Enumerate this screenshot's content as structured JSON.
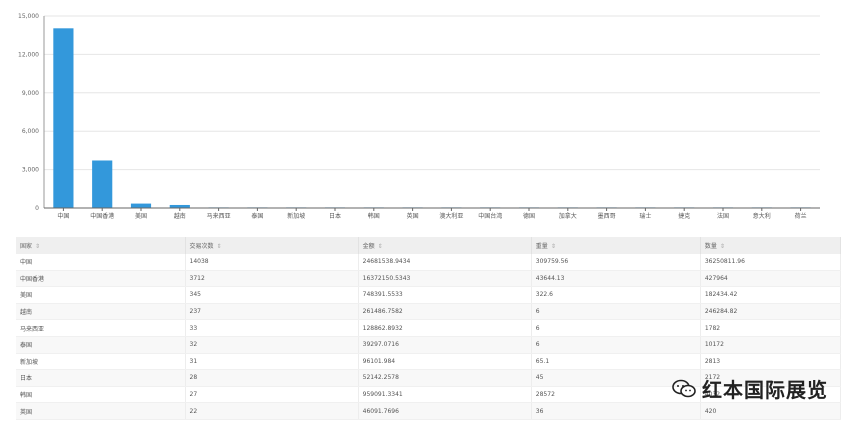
{
  "chart_data": {
    "type": "bar",
    "categories": [
      "中国",
      "中国香港",
      "美国",
      "越南",
      "马来西亚",
      "泰国",
      "新加坡",
      "日本",
      "韩国",
      "英国",
      "澳大利亚",
      "中国台湾",
      "德国",
      "加拿大",
      "墨西哥",
      "瑞士",
      "捷克",
      "法国",
      "意大利",
      "荷兰"
    ],
    "values": [
      14038,
      3712,
      345,
      237,
      33,
      32,
      31,
      28,
      27,
      22,
      15,
      12,
      10,
      9,
      8,
      7,
      6,
      6,
      5,
      4
    ],
    "yticks": [
      "0",
      "3,000",
      "6,000",
      "9,000",
      "12,000",
      "15,000"
    ],
    "ylim": [
      0,
      15000
    ],
    "color": "#3398db",
    "grid": true
  },
  "table": {
    "headers": [
      "国家",
      "交易次数",
      "金额",
      "重量",
      "数量"
    ],
    "sort_glyph": "⇕",
    "rows": [
      [
        "中国",
        "14038",
        "24681538.9434",
        "309759.56",
        "36250811.96"
      ],
      [
        "中国香港",
        "3712",
        "16372150.5343",
        "43644.13",
        "427964"
      ],
      [
        "美国",
        "345",
        "748391.5533",
        "322.6",
        "182434.42"
      ],
      [
        "越南",
        "237",
        "261486.7582",
        "6",
        "246284.82"
      ],
      [
        "马来西亚",
        "33",
        "128862.8932",
        "6",
        "1782"
      ],
      [
        "泰国",
        "32",
        "39297.0716",
        "6",
        "10172"
      ],
      [
        "新加坡",
        "31",
        "96101.984",
        "65.1",
        "2813"
      ],
      [
        "日本",
        "28",
        "52142.2578",
        "45",
        "2172"
      ],
      [
        "韩国",
        "27",
        "959091.3341",
        "28572",
        "4032"
      ],
      [
        "英国",
        "22",
        "46091.7696",
        "36",
        "420"
      ]
    ]
  },
  "watermark": {
    "text": "红本国际展览",
    "icon": "wechat-icon"
  }
}
